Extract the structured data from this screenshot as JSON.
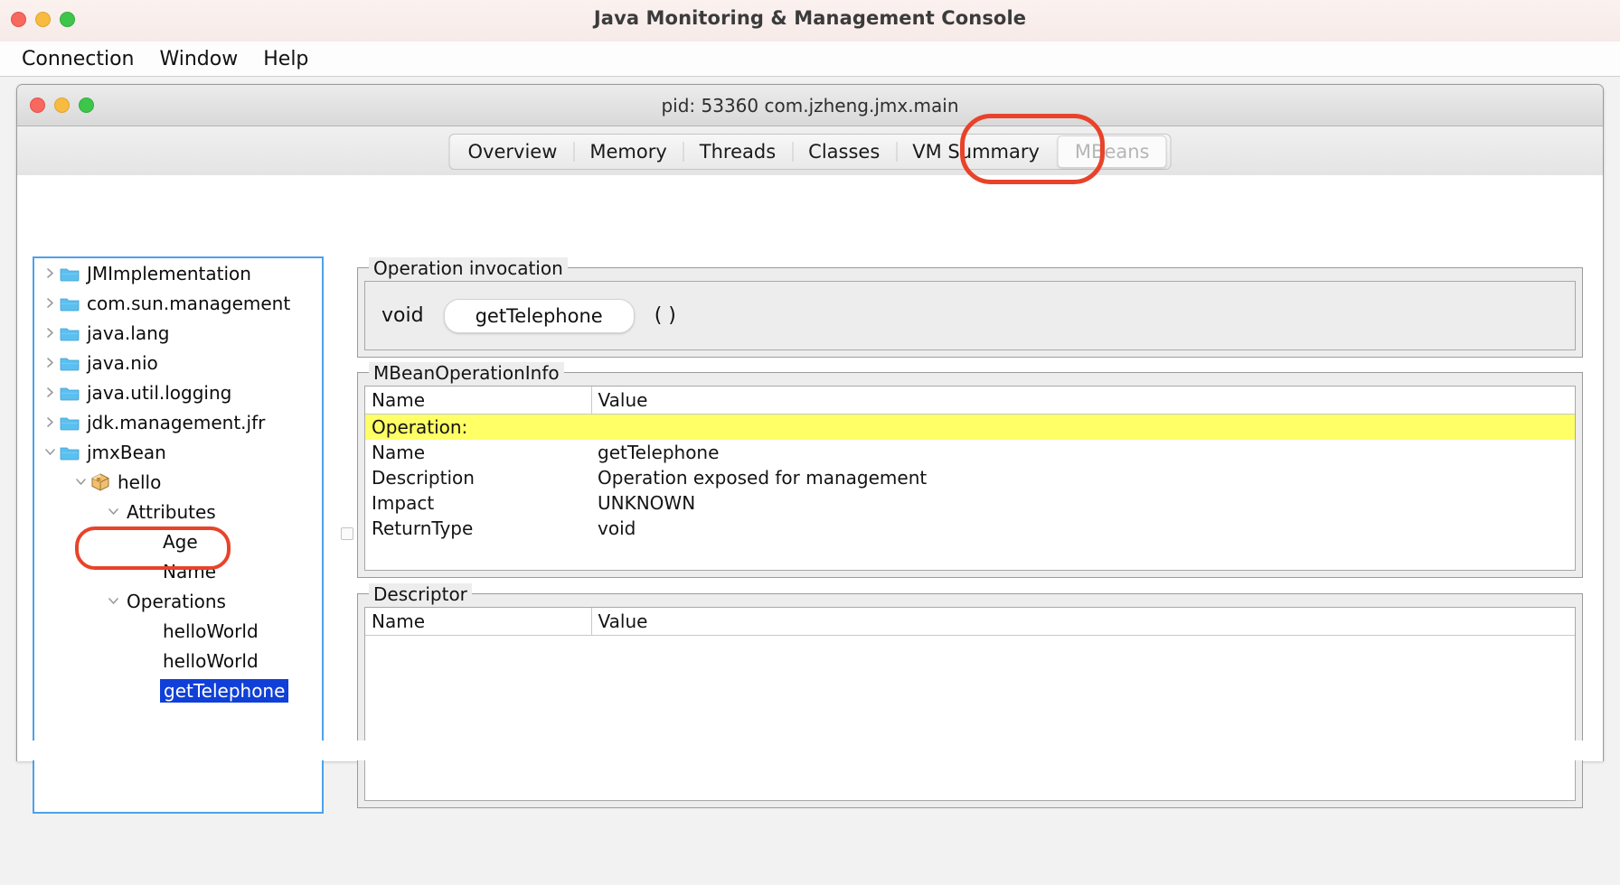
{
  "app": {
    "outer_title": "Java Monitoring & Management Console",
    "traffic_lights": [
      "close",
      "minimize",
      "zoom"
    ]
  },
  "menubar": {
    "items": [
      {
        "label": "Connection"
      },
      {
        "label": "Window"
      },
      {
        "label": "Help"
      }
    ]
  },
  "inner_window": {
    "title": "pid: 53360 com.jzheng.jmx.main"
  },
  "tabs": {
    "items": [
      {
        "label": "Overview",
        "selected": false
      },
      {
        "label": "Memory",
        "selected": false
      },
      {
        "label": "Threads",
        "selected": false
      },
      {
        "label": "Classes",
        "selected": false
      },
      {
        "label": "VM Summary",
        "selected": false
      },
      {
        "label": "MBeans",
        "selected": true
      }
    ],
    "selected": "MBeans",
    "annotation_color": "#e8432a",
    "connection_icon": "connection-plug-icon"
  },
  "tree": {
    "nodes": [
      {
        "label": "JMImplementation",
        "indent": 0,
        "twisty": "collapsed",
        "icon": "folder-icon",
        "selected": false,
        "annotated": false
      },
      {
        "label": "com.sun.management",
        "indent": 0,
        "twisty": "collapsed",
        "icon": "folder-icon",
        "selected": false,
        "annotated": false
      },
      {
        "label": "java.lang",
        "indent": 0,
        "twisty": "collapsed",
        "icon": "folder-icon",
        "selected": false,
        "annotated": false
      },
      {
        "label": "java.nio",
        "indent": 0,
        "twisty": "collapsed",
        "icon": "folder-icon",
        "selected": false,
        "annotated": false
      },
      {
        "label": "java.util.logging",
        "indent": 0,
        "twisty": "collapsed",
        "icon": "folder-icon",
        "selected": false,
        "annotated": false
      },
      {
        "label": "jdk.management.jfr",
        "indent": 0,
        "twisty": "collapsed",
        "icon": "folder-icon",
        "selected": false,
        "annotated": false
      },
      {
        "label": "jmxBean",
        "indent": 0,
        "twisty": "expanded",
        "icon": "folder-icon",
        "selected": false,
        "annotated": true
      },
      {
        "label": "hello",
        "indent": 1,
        "twisty": "expanded",
        "icon": "mbean-icon",
        "selected": false,
        "annotated": false
      },
      {
        "label": "Attributes",
        "indent": 2,
        "twisty": "expanded",
        "icon": "none",
        "selected": false,
        "annotated": false
      },
      {
        "label": "Age",
        "indent": 3,
        "twisty": "none",
        "icon": "none",
        "selected": false,
        "annotated": false
      },
      {
        "label": "Name",
        "indent": 3,
        "twisty": "none",
        "icon": "none",
        "selected": false,
        "annotated": false
      },
      {
        "label": "Operations",
        "indent": 2,
        "twisty": "expanded",
        "icon": "none",
        "selected": false,
        "annotated": false
      },
      {
        "label": "helloWorld",
        "indent": 3,
        "twisty": "none",
        "icon": "none",
        "selected": false,
        "annotated": false
      },
      {
        "label": "helloWorld",
        "indent": 3,
        "twisty": "none",
        "icon": "none",
        "selected": false,
        "annotated": false
      },
      {
        "label": "getTelephone",
        "indent": 3,
        "twisty": "none",
        "icon": "none",
        "selected": true,
        "annotated": false
      }
    ],
    "selection_color": "#1040d8",
    "annotation_color": "#e8432a",
    "focus_border_color": "#4da1ec"
  },
  "operation_invocation": {
    "group_title": "Operation invocation",
    "return_type": "void",
    "button_label": "getTelephone",
    "parameters": "( )"
  },
  "mbean_operation_info": {
    "group_title": "MBeanOperationInfo",
    "columns": [
      "Name",
      "Value"
    ],
    "highlight_color": "#ffff66",
    "rows": [
      {
        "name": "Operation:",
        "value": "",
        "highlight": true
      },
      {
        "name": "Name",
        "value": "getTelephone",
        "highlight": false
      },
      {
        "name": "Description",
        "value": "Operation exposed for management",
        "highlight": false
      },
      {
        "name": "Impact",
        "value": "UNKNOWN",
        "highlight": false
      },
      {
        "name": "ReturnType",
        "value": "void",
        "highlight": false
      }
    ]
  },
  "descriptor": {
    "group_title": "Descriptor",
    "columns": [
      "Name",
      "Value"
    ],
    "rows": []
  }
}
